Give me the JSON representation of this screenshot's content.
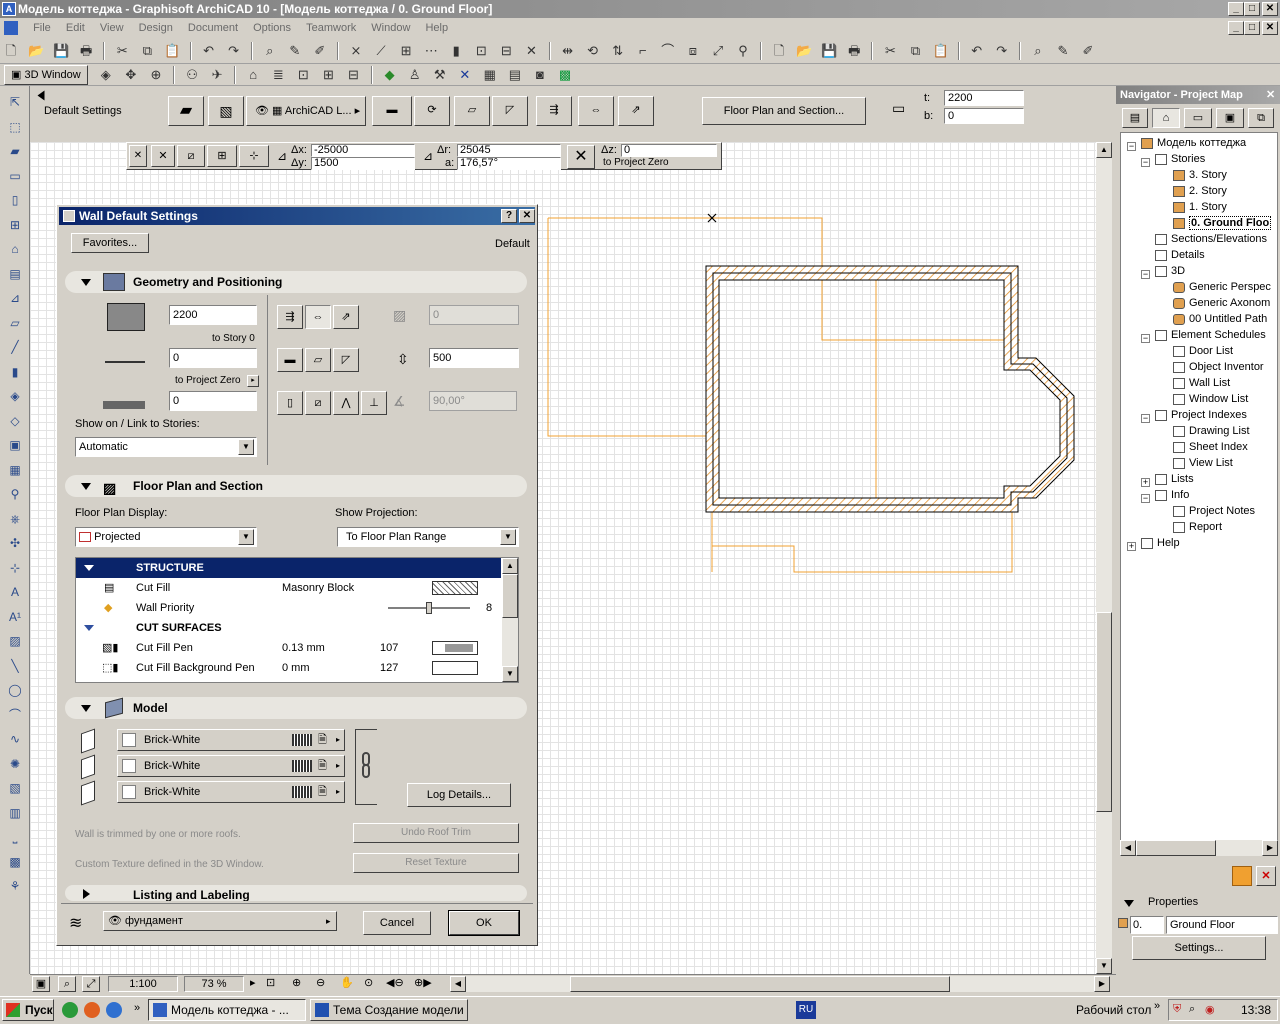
{
  "window": {
    "title": "Модель коттеджа - Graphisoft ArchiCAD 10 - [Модель коттеджа / 0. Ground Floor]",
    "app_icon": "A"
  },
  "menu": [
    "File",
    "Edit",
    "View",
    "Design",
    "Document",
    "Options",
    "Teamwork",
    "Window",
    "Help"
  ],
  "toolbar": {
    "window_3d_label": "3D Window"
  },
  "infobox": {
    "default_settings_label": "Default Settings",
    "layer_label": "ArchiCAD L...",
    "floor_plan_section_button": "Floor Plan and Section...",
    "t_label": "t:",
    "t_value": "2200",
    "b_label": "b:",
    "b_value": "0"
  },
  "coords": {
    "dx_label": "Δx:",
    "dx_value": "-25000",
    "dy_label": "Δy:",
    "dy_value": "1500",
    "dr_label": "Δr:",
    "dr_value": "25045",
    "a_label": "a:",
    "a_value": "176,57°",
    "dz_label": "Δz:",
    "dz_value": "0",
    "dz_ref": "to Project Zero"
  },
  "dialog": {
    "title": "Wall Default Settings",
    "help_btn": "?",
    "close_btn": "✕",
    "favorites_btn": "Favorites...",
    "default_label": "Default",
    "geometry": {
      "title": "Geometry and Positioning",
      "height_value": "2200",
      "to_story_label": "to Story 0",
      "base_offset_value": "0",
      "to_project_zero_label": "to Project Zero",
      "offset2_value": "0",
      "show_on_label": "Show on / Link to Stories:",
      "show_on_value": "Automatic",
      "disabled_value": "0",
      "thickness_value": "500",
      "angle_value": "90,00°"
    },
    "floor_plan": {
      "title": "Floor Plan and Section",
      "display_label": "Floor Plan Display:",
      "display_value": "Projected",
      "projection_label": "Show Projection:",
      "projection_value": "To Floor Plan Range",
      "table": {
        "header_structure": "STRUCTURE",
        "rows": [
          {
            "name": "Cut Fill",
            "value": "Masonry Block",
            "num": ""
          },
          {
            "name": "Wall Priority",
            "value": "",
            "num": "8"
          }
        ],
        "header_cut": "CUT SURFACES",
        "cut_rows": [
          {
            "name": "Cut Fill Pen",
            "value": "0.13 mm",
            "num": "107"
          },
          {
            "name": "Cut Fill Background Pen",
            "value": "0 mm",
            "num": "127"
          }
        ],
        "wall_priority_level": 0.5
      }
    },
    "model": {
      "title": "Model",
      "materials": [
        "Brick-White",
        "Brick-White",
        "Brick-White"
      ],
      "log_details_btn": "Log Details...",
      "trim_msg": "Wall is trimmed by one or more roofs.",
      "undo_trim_btn": "Undo Roof Trim",
      "texture_msg": "Custom Texture defined in the 3D Window.",
      "reset_texture_btn": "Reset Texture"
    },
    "listing": {
      "title": "Listing and Labeling"
    },
    "layer_value": "фундамент",
    "cancel_btn": "Cancel",
    "ok_btn": "OK"
  },
  "navigator": {
    "title": "Navigator - Project Map",
    "close": "✕",
    "tree": [
      {
        "label": "Модель коттеджа",
        "level": 0,
        "icon": "project"
      },
      {
        "label": "Stories",
        "level": 1,
        "icon": "folder"
      },
      {
        "label": "3. Story",
        "level": 2,
        "icon": "story"
      },
      {
        "label": "2. Story",
        "level": 2,
        "icon": "story"
      },
      {
        "label": "1. Story",
        "level": 2,
        "icon": "story"
      },
      {
        "label": "0. Ground Floo",
        "level": 2,
        "icon": "story"
      },
      {
        "label": "Sections/Elevations",
        "level": 1,
        "icon": "folder"
      },
      {
        "label": "Details",
        "level": 1,
        "icon": "folder"
      },
      {
        "label": "3D",
        "level": 1,
        "icon": "folder"
      },
      {
        "label": "Generic Perspec",
        "level": 2,
        "icon": "3d"
      },
      {
        "label": "Generic Axonom",
        "level": 2,
        "icon": "3d"
      },
      {
        "label": "00 Untitled Path",
        "level": 2,
        "icon": "3d"
      },
      {
        "label": "Element Schedules",
        "level": 1,
        "icon": "folder"
      },
      {
        "label": "Door List",
        "level": 2,
        "icon": "doc"
      },
      {
        "label": "Object Inventor",
        "level": 2,
        "icon": "doc"
      },
      {
        "label": "Wall List",
        "level": 2,
        "icon": "doc"
      },
      {
        "label": "Window List",
        "level": 2,
        "icon": "doc"
      },
      {
        "label": "Project Indexes",
        "level": 1,
        "icon": "folder"
      },
      {
        "label": "Drawing List",
        "level": 2,
        "icon": "doc"
      },
      {
        "label": "Sheet Index",
        "level": 2,
        "icon": "doc"
      },
      {
        "label": "View List",
        "level": 2,
        "icon": "doc"
      },
      {
        "label": "Lists",
        "level": 1,
        "icon": "folder"
      },
      {
        "label": "Info",
        "level": 1,
        "icon": "folder"
      },
      {
        "label": "Project Notes",
        "level": 2,
        "icon": "doc"
      },
      {
        "label": "Report",
        "level": 2,
        "icon": "doc"
      },
      {
        "label": "Help",
        "level": 0,
        "icon": "folder"
      }
    ],
    "properties_label": "Properties",
    "prop_prefix": "0.",
    "prop_name": "Ground Floor",
    "settings_btn": "Settings..."
  },
  "statusbar": {
    "scale": "1:100",
    "zoom": "73 %"
  },
  "taskbar": {
    "start": "Пуск",
    "tasks": [
      "Модель коттеджа - ...",
      "Тема Создание модели ..."
    ],
    "lang": "RU",
    "desktop": "Рабочий стол",
    "time": "13:38"
  },
  "colors": {
    "accent": "#0a246a",
    "wall_hatch": "#e08a20",
    "orange_line": "#f0a030"
  }
}
